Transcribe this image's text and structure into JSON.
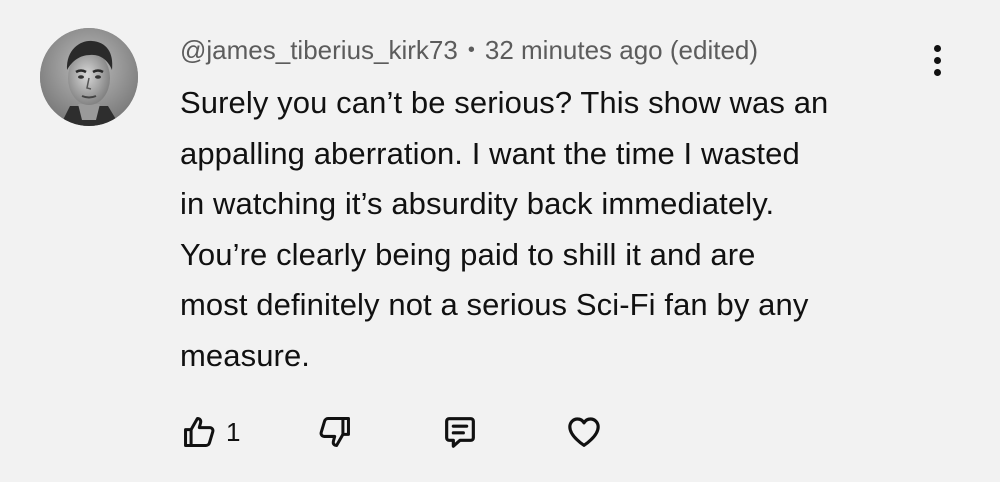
{
  "comment": {
    "author": "@james_tiberius_kirk73",
    "separator": "•",
    "timestamp": "32 minutes ago (edited)",
    "text": "Surely you can’t be serious? This show was an\nappalling aberration. I want the time I wasted\nin watching it’s absurdity back immediately.\nYou’re clearly being paid to shill it and are\nmost definitely not a serious Sci-Fi fan by any\nmeasure.",
    "avatar_icon": "avatar-photo",
    "menu_icon": "more-vertical-icon"
  },
  "actions": {
    "like_count": "1",
    "like_icon": "thumbs-up-icon",
    "dislike_icon": "thumbs-down-icon",
    "reply_icon": "comment-icon",
    "heart_icon": "heart-icon"
  },
  "colors": {
    "background": "#f2f2f2",
    "text": "#111111",
    "meta_text": "#5c5c5c"
  }
}
